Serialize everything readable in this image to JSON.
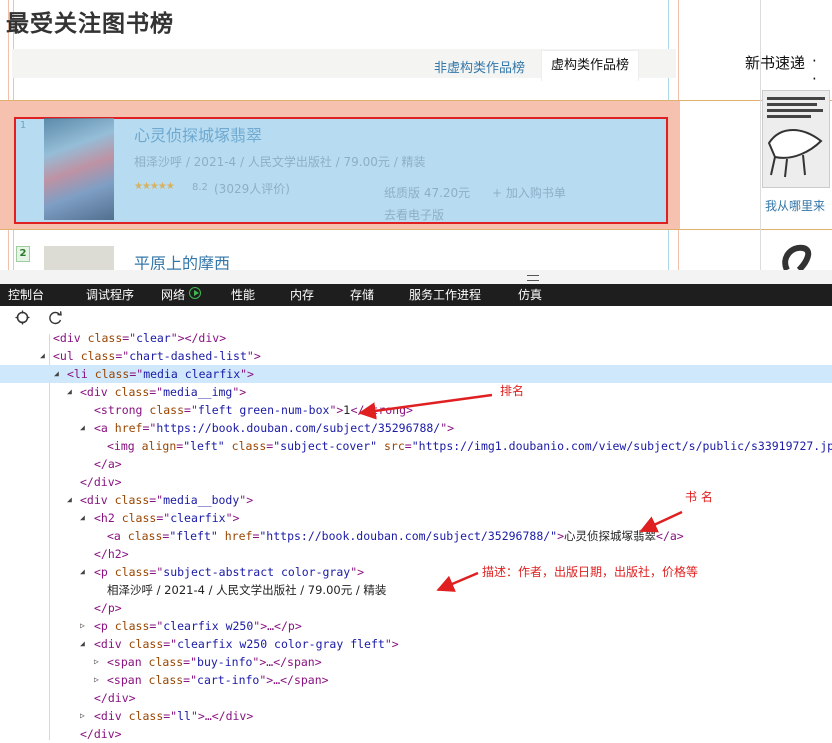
{
  "page": {
    "title": "最受关注图书榜",
    "tabs": [
      "非虚构类作品榜",
      "虚构类作品榜"
    ],
    "active_tab": "虚构类作品榜",
    "books": [
      {
        "rank": "1",
        "title": "心灵侦探城塚翡翠",
        "meta": "相泽沙呼 / 2021-4 / 人民文学出版社 / 79.00元 / 精装",
        "stars": "★★★★★",
        "score": "8.2",
        "votes": "(3029人评价)",
        "price": "纸质版 47.20元",
        "cart": "+ 加入购书单",
        "ebook": "去看电子版"
      },
      {
        "rank": "2",
        "title": "平原上的摩西"
      }
    ],
    "sidebar": {
      "title": "新书速递",
      "dots": "· ·",
      "book_label": "我从哪里来"
    }
  },
  "devtools": {
    "tabs": [
      "控制台",
      "调试程序",
      "网络",
      "性能",
      "内存",
      "存储",
      "服务工作进程",
      "仿真"
    ],
    "lines": {
      "l1": {
        "a": "<div ",
        "b": "class",
        "c": "=\"",
        "d": "clear",
        "e": "\"></div>"
      },
      "l2": {
        "a": "<ul ",
        "b": "class",
        "c": "=\"",
        "d": "chart-dashed-list",
        "e": "\">"
      },
      "l3": {
        "a": "<li ",
        "b": "class",
        "c": "=\"",
        "d": "media clearfix",
        "e": "\">"
      },
      "l4": {
        "a": "<div ",
        "b": "class",
        "c": "=\"",
        "d": "media__img",
        "e": "\">"
      },
      "l5": {
        "a": "<strong ",
        "b": "class",
        "c": "=\"",
        "d": "fleft green-num-box",
        "e": "\">",
        "t": "1",
        "f": "</strong>"
      },
      "l6": {
        "a": "<a ",
        "b": "href",
        "c": "=\"",
        "d": "https://book.douban.com/subject/35296788/",
        "e": "\">"
      },
      "l7": {
        "a": "<img ",
        "b1": "align",
        "d1": "\"left\" ",
        "b2": "class",
        "d2": "\"subject-cover\" ",
        "b3": "src",
        "d3": "\"https://img1.doubanio.com/view/subject/s/public/s33919727.jpg\"",
        "e": " />"
      },
      "l8": "</a>",
      "l9": "</div>",
      "l10": {
        "a": "<div ",
        "b": "class",
        "c": "=\"",
        "d": "media__body",
        "e": "\">"
      },
      "l11": {
        "a": "<h2 ",
        "b": "class",
        "c": "=\"",
        "d": "clearfix",
        "e": "\">"
      },
      "l12": {
        "a": "<a ",
        "b1": "class",
        "d1": "\"fleft\" ",
        "b2": "href",
        "d2": "\"https://book.douban.com/subject/35296788/\"",
        "e": ">",
        "t": "心灵侦探城塚翡翠",
        "f": "</a>"
      },
      "l13": "</h2>",
      "l14": {
        "a": "<p ",
        "b": "class",
        "c": "=\"",
        "d": "subject-abstract color-gray",
        "e": "\">"
      },
      "l15": "相泽沙呼 / 2021-4 / 人民文学出版社 / 79.00元 / 精装",
      "l16": "</p>",
      "l17": {
        "a": "<p ",
        "b": "class",
        "c": "=\"",
        "d": "clearfix w250",
        "e": "\">…</p>"
      },
      "l18": {
        "a": "<div ",
        "b": "class",
        "c": "=\"",
        "d": "clearfix w250 color-gray fleft",
        "e": "\">"
      },
      "l19": {
        "a": "<span ",
        "b": "class",
        "c": "=\"",
        "d": "buy-info",
        "e": "\">…</span>"
      },
      "l20": {
        "a": "<span ",
        "b": "class",
        "c": "=\"",
        "d": "cart-info",
        "e": "\">…</span>"
      },
      "l21": "</div>",
      "l22": {
        "a": "<div ",
        "b": "class",
        "c": "=\"",
        "d": "ll",
        "e": "\">…</div>"
      },
      "l23": "</div>"
    },
    "annotations": {
      "rank": "排名",
      "book_name": "书 名",
      "description": "描述：作者，出版日期，出版社，价格等"
    }
  },
  "colors": {
    "accent_link": "#3377aa",
    "margin_highlight": "#f6c1ae",
    "content_highlight": "#b7dcf2",
    "annotation_red": "#e02020",
    "devtools_dark": "#1e1e1e"
  }
}
